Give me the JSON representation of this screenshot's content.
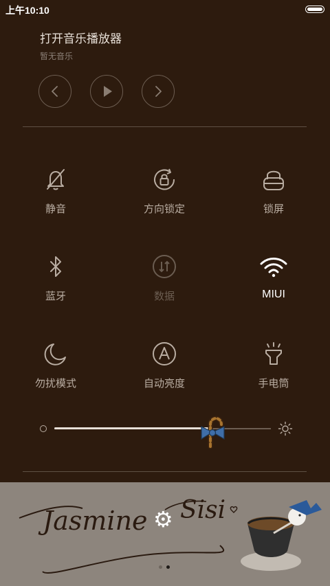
{
  "status": {
    "time": "上午10:10"
  },
  "music": {
    "title": "打开音乐播放器",
    "subtitle": "暂无音乐",
    "prev_icon": "chevron-left-icon",
    "play_icon": "play-icon",
    "next_icon": "chevron-right-icon"
  },
  "toggles": [
    {
      "label": "静音",
      "icon": "bell-off-icon",
      "state": "off"
    },
    {
      "label": "方向锁定",
      "icon": "rotation-lock-icon",
      "state": "off"
    },
    {
      "label": "锁屏",
      "icon": "lock-icon",
      "state": "off"
    },
    {
      "label": "蓝牙",
      "icon": "bluetooth-icon",
      "state": "off"
    },
    {
      "label": "数据",
      "icon": "mobile-data-icon",
      "state": "disabled"
    },
    {
      "label": "MIUI",
      "icon": "wifi-icon",
      "state": "on"
    },
    {
      "label": "勿扰模式",
      "icon": "moon-icon",
      "state": "off"
    },
    {
      "label": "自动亮度",
      "icon": "auto-brightness-icon",
      "state": "off"
    },
    {
      "label": "手电筒",
      "icon": "flashlight-icon",
      "state": "off"
    }
  ],
  "brightness": {
    "level": 0.73
  },
  "banner": {
    "text_left": "Jasmine",
    "text_right": "Sisi",
    "page_indicator": {
      "count": 2,
      "active_index": 1
    }
  },
  "colors": {
    "background": "#2d1b0e",
    "icon": "#b9ada2",
    "active": "#ffffff",
    "disabled": "#6b5d51",
    "banner": "#8d857d"
  }
}
